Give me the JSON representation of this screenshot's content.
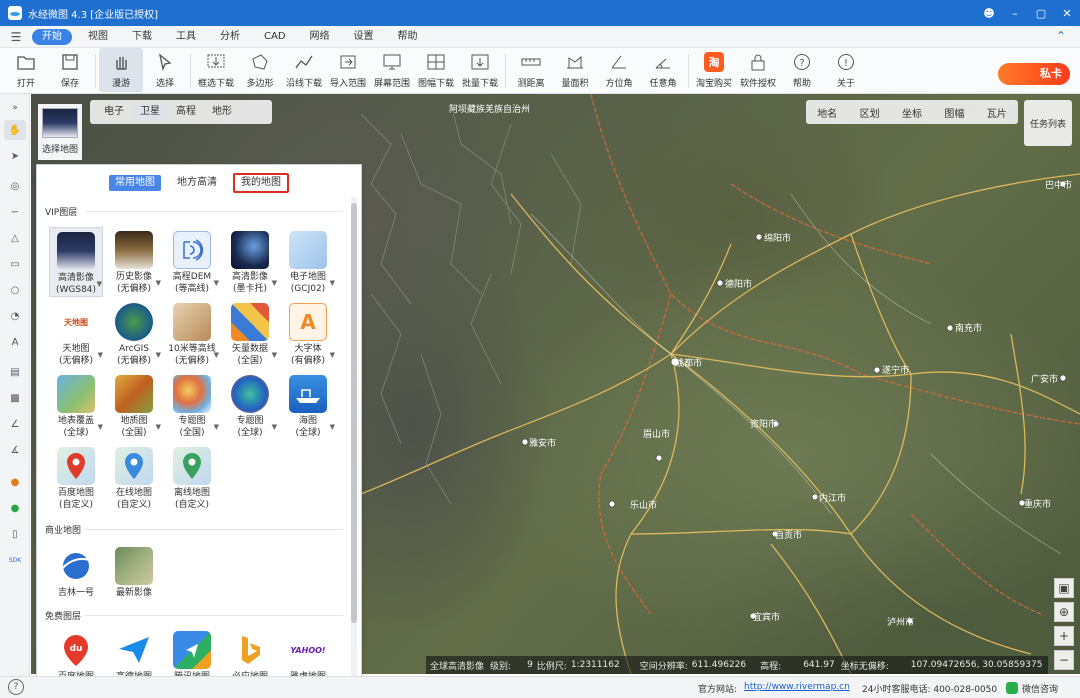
{
  "window": {
    "title": "水经微图 4.3 [企业版已授权]"
  },
  "menu": [
    "开始",
    "视图",
    "下载",
    "工具",
    "分析",
    "CAD",
    "网络",
    "设置",
    "帮助"
  ],
  "toolbar": {
    "items": [
      "打开",
      "保存",
      "漫游",
      "选择",
      "框选下载",
      "多边形",
      "沿线下载",
      "导入范围",
      "屏幕范围",
      "图幅下载",
      "批量下载",
      "测距离",
      "量面积",
      "方位角",
      "任意角",
      "淘宝购买",
      "软件授权",
      "帮助",
      "关于"
    ],
    "promo": "私卡"
  },
  "map_tabs": [
    "电子",
    "卫星",
    "高程",
    "地形"
  ],
  "overlay_tabs": [
    "地名",
    "区划",
    "坐标",
    "图幅",
    "瓦片"
  ],
  "task_list": "任务列表",
  "select_map": "选择地图",
  "panel": {
    "tabs": [
      "常用地图",
      "地方高清",
      "我的地图"
    ],
    "vip_title": "VIP图层",
    "vip_layers": [
      {
        "l1": "高清影像",
        "l2": "(WGS84)"
      },
      {
        "l1": "历史影像",
        "l2": "(无偏移)"
      },
      {
        "l1": "高程DEM",
        "l2": "(等高线)"
      },
      {
        "l1": "高清影像",
        "l2": "(墨卡托)"
      },
      {
        "l1": "电子地图",
        "l2": "(GCJ02)"
      },
      {
        "l1": "天地图",
        "l2": "(无偏移)"
      },
      {
        "l1": "ArcGIS",
        "l2": "(无偏移)"
      },
      {
        "l1": "10米等高线",
        "l2": "(无偏移)"
      },
      {
        "l1": "矢量数据",
        "l2": "(全国)"
      },
      {
        "l1": "大字体",
        "l2": "(有偏移)"
      },
      {
        "l1": "地表覆盖",
        "l2": "(全球)"
      },
      {
        "l1": "地质图",
        "l2": "(全国)"
      },
      {
        "l1": "专题图",
        "l2": "(全国)"
      },
      {
        "l1": "专题图",
        "l2": "(全球)"
      },
      {
        "l1": "海图",
        "l2": "(全球)"
      },
      {
        "l1": "百度地图",
        "l2": "(自定义)"
      },
      {
        "l1": "在线地图",
        "l2": "(自定义)"
      },
      {
        "l1": "离线地图",
        "l2": "(自定义)"
      }
    ],
    "commercial_title": "商业地图",
    "commercial_layers": [
      "吉林一号",
      "最新影像"
    ],
    "free_title": "免费图层",
    "free_layers": [
      "百度地图",
      "高德地图",
      "腾讯地图",
      "必应地图",
      "雅虎地图"
    ],
    "icon_text": {
      "tianditu": "天地图",
      "baidu": "du",
      "yahoo": "YAHOO!",
      "taobao": "淘"
    }
  },
  "map_labels": {
    "cities": [
      "绵阳市",
      "德阳市",
      "成都市",
      "南充市",
      "遂宁市",
      "广安市",
      "眉山市",
      "雅安市",
      "资阳市",
      "乐山市",
      "内江市",
      "自贡市",
      "宜宾市",
      "泸州市",
      "重庆市",
      "巴中市"
    ],
    "top": "阿坝藏族羌族自治州"
  },
  "status": {
    "layer": "全球高清影像",
    "level_label": "级别:",
    "level": "9",
    "scale_label": "比例尺:",
    "scale": "1:2311162",
    "res_label": "空间分辨率:",
    "res": "611.496226",
    "elev_label": "高程:",
    "elev": "641.97",
    "coord_label": "坐标无偏移:",
    "coord": "107.09472656, 30.05859375"
  },
  "footer": {
    "site_label": "官方网站:",
    "site": "http://www.rivermap.cn",
    "hotline": "24小时客服电话: 400-028-0050",
    "wechat": "微信咨询"
  },
  "colors": {
    "brand": "#1e6fcf",
    "accent": "#3b82e6",
    "highlight": "#d93025",
    "promo": "#ff4a1f"
  }
}
